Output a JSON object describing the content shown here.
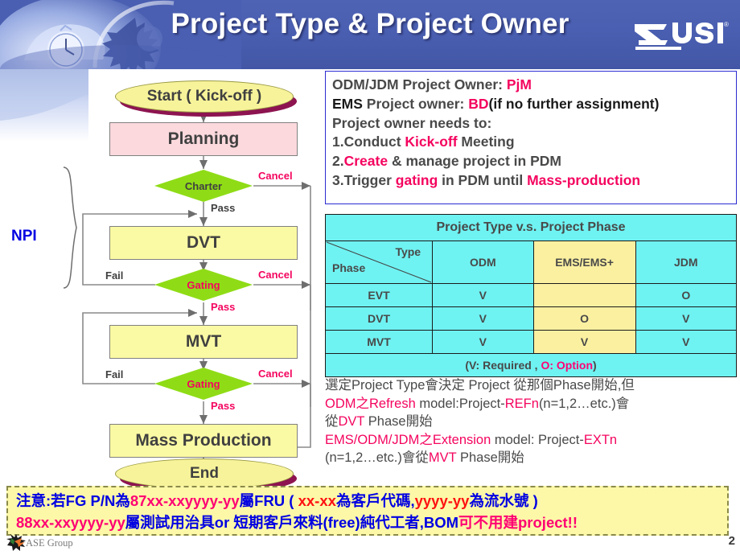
{
  "header": {
    "title": "Project Type & Project Owner",
    "logo_text": "USI",
    "logo_reg": "®",
    "logo_icon": "usi-logo-icon",
    "decor_icon": "hands-stopwatch-gears-image"
  },
  "flowchart": {
    "group_label": "NPI",
    "nodes": [
      {
        "id": "start",
        "label": "Start ( Kick-off )",
        "shape": "terminator"
      },
      {
        "id": "planning",
        "label": "Planning",
        "shape": "process"
      },
      {
        "id": "charter",
        "label": "Charter",
        "shape": "decision"
      },
      {
        "id": "dvt",
        "label": "DVT",
        "shape": "process"
      },
      {
        "id": "gating1",
        "label": "Gating",
        "shape": "decision"
      },
      {
        "id": "mvt",
        "label": "MVT",
        "shape": "process"
      },
      {
        "id": "gating2",
        "label": "Gating",
        "shape": "decision"
      },
      {
        "id": "mass",
        "label": "Mass Production",
        "shape": "process"
      },
      {
        "id": "end",
        "label": "End",
        "shape": "terminator"
      }
    ],
    "edge_labels": {
      "cancel1": "Cancel",
      "cancel2": "Cancel",
      "cancel3": "Cancel",
      "pass1": "Pass",
      "pass2": "Pass",
      "pass3": "Pass",
      "fail1": "Fail",
      "fail2": "Fail"
    }
  },
  "infobox": {
    "lines": [
      [
        {
          "t": "ODM/JDM Project Owner: ",
          "c": "gray"
        },
        {
          "t": "PjM",
          "c": "pink"
        }
      ],
      [
        {
          "t": "EMS",
          "c": "black"
        },
        {
          "t": " Project owner: ",
          "c": "gray"
        },
        {
          "t": "BD",
          "c": "pink"
        },
        {
          "t": "(if no further assignment)",
          "c": "black"
        }
      ],
      [
        {
          "t": "Project owner needs to:",
          "c": "gray"
        }
      ],
      [
        {
          "t": "1.Conduct ",
          "c": "gray"
        },
        {
          "t": "Kick-off",
          "c": "pink"
        },
        {
          "t": " Meeting",
          "c": "gray"
        }
      ],
      [
        {
          "t": "2.",
          "c": "gray"
        },
        {
          "t": "Create",
          "c": "pink"
        },
        {
          "t": " & manage project in PDM",
          "c": "gray"
        }
      ],
      [
        {
          "t": "3.Trigger ",
          "c": "gray"
        },
        {
          "t": "gating",
          "c": "pink"
        },
        {
          "t": " in PDM until ",
          "c": "gray"
        },
        {
          "t": "Mass-production",
          "c": "pink"
        }
      ]
    ]
  },
  "table": {
    "title": "Project Type v.s. Project Phase",
    "corner_type": "Type",
    "corner_phase": "Phase",
    "columns": [
      "ODM",
      "EMS/EMS+",
      "JDM"
    ],
    "rows": [
      {
        "phase": "EVT",
        "cells": [
          {
            "v": "V",
            "c": "gray"
          },
          {
            "v": "",
            "c": "gray"
          },
          {
            "v": "O",
            "c": "pink"
          }
        ]
      },
      {
        "phase": "DVT",
        "cells": [
          {
            "v": "V",
            "c": "gray"
          },
          {
            "v": "O",
            "c": "red"
          },
          {
            "v": "V",
            "c": "gray"
          }
        ]
      },
      {
        "phase": "MVT",
        "cells": [
          {
            "v": "V",
            "c": "gray"
          },
          {
            "v": "V",
            "c": "gray"
          },
          {
            "v": "V",
            "c": "gray"
          }
        ]
      }
    ],
    "legend": [
      {
        "t": "(V: Required , ",
        "c": "gray"
      },
      {
        "t": "O: Option",
        "c": "pink"
      },
      {
        "t": ")",
        "c": "gray"
      }
    ]
  },
  "note": {
    "lines": [
      [
        {
          "t": "選定Project Type會決定 Project 從那個Phase開始,但",
          "c": "gray"
        }
      ],
      [
        {
          "t": "ODM之Refresh",
          "c": "pink"
        },
        {
          "t": " model:Project-",
          "c": "gray"
        },
        {
          "t": "REFn",
          "c": "pink"
        },
        {
          "t": "(n=1,2…etc.)會",
          "c": "gray"
        }
      ],
      [
        {
          "t": "從",
          "c": "gray"
        },
        {
          "t": "DVT",
          "c": "pink"
        },
        {
          "t": " Phase開始",
          "c": "gray"
        }
      ],
      [
        {
          "t": "EMS/ODM/JDM之Extension",
          "c": "pink"
        },
        {
          "t": " model: Project-",
          "c": "gray"
        },
        {
          "t": "EXTn",
          "c": "pink"
        }
      ],
      [
        {
          "t": "(n=1,2…etc.)會從",
          "c": "gray"
        },
        {
          "t": "MVT",
          "c": "pink"
        },
        {
          "t": " Phase開始",
          "c": "gray"
        }
      ]
    ]
  },
  "warning": {
    "lines": [
      [
        {
          "t": "注意:若FG P/N為",
          "c": "blue"
        },
        {
          "t": "87xx-xxyyyy-yy",
          "c": "pink"
        },
        {
          "t": "屬FRU ( ",
          "c": "blue"
        },
        {
          "t": "xx-xx",
          "c": "red"
        },
        {
          "t": "為客戶代碼,",
          "c": "blue"
        },
        {
          "t": "yyyy-yy",
          "c": "red"
        },
        {
          "t": "為流水號 )",
          "c": "blue"
        }
      ],
      [
        {
          "t": "88xx-xxyyyy-yy",
          "c": "pink"
        },
        {
          "t": "屬測試用治具or 短期客戶來料(free)純代工者,BOM",
          "c": "blue"
        },
        {
          "t": "可不用建project!!",
          "c": "pink"
        }
      ]
    ]
  },
  "footer": {
    "brand": "ASE Group",
    "brand_icon": "ase-star-logo-icon",
    "page_number": "2"
  },
  "colors": {
    "header_blue": "#4a5fb1",
    "accent_pink": "#f4045f",
    "accent_blue": "#0000e2",
    "accent_red": "#ff0000",
    "table_cyan": "#6ff2f2",
    "table_yellow": "#fbf0a0",
    "node_yellow": "#fbfaa4",
    "node_pink": "#fbd9dd",
    "decision_green": "#8fdc16",
    "warn_bg": "#fcf8a8"
  }
}
